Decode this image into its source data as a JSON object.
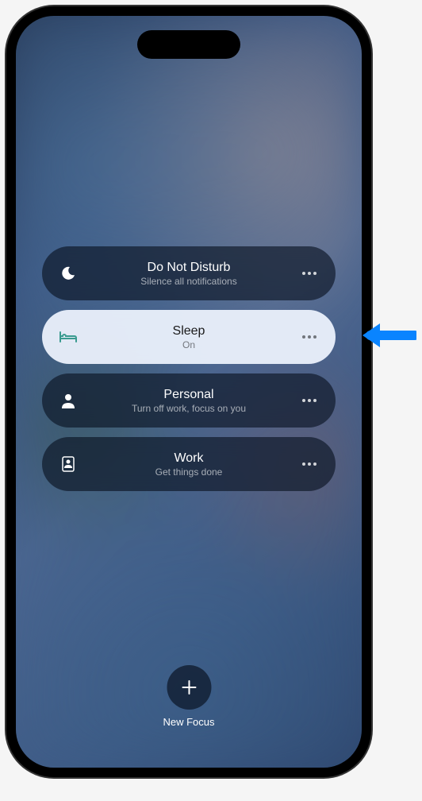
{
  "focus_modes": [
    {
      "id": "dnd",
      "title": "Do Not Disturb",
      "subtitle": "Silence all notifications",
      "active": false
    },
    {
      "id": "sleep",
      "title": "Sleep",
      "subtitle": "On",
      "active": true
    },
    {
      "id": "personal",
      "title": "Personal",
      "subtitle": "Turn off work, focus on you",
      "active": false
    },
    {
      "id": "work",
      "title": "Work",
      "subtitle": "Get things done",
      "active": false
    }
  ],
  "new_focus": {
    "label": "New Focus"
  }
}
